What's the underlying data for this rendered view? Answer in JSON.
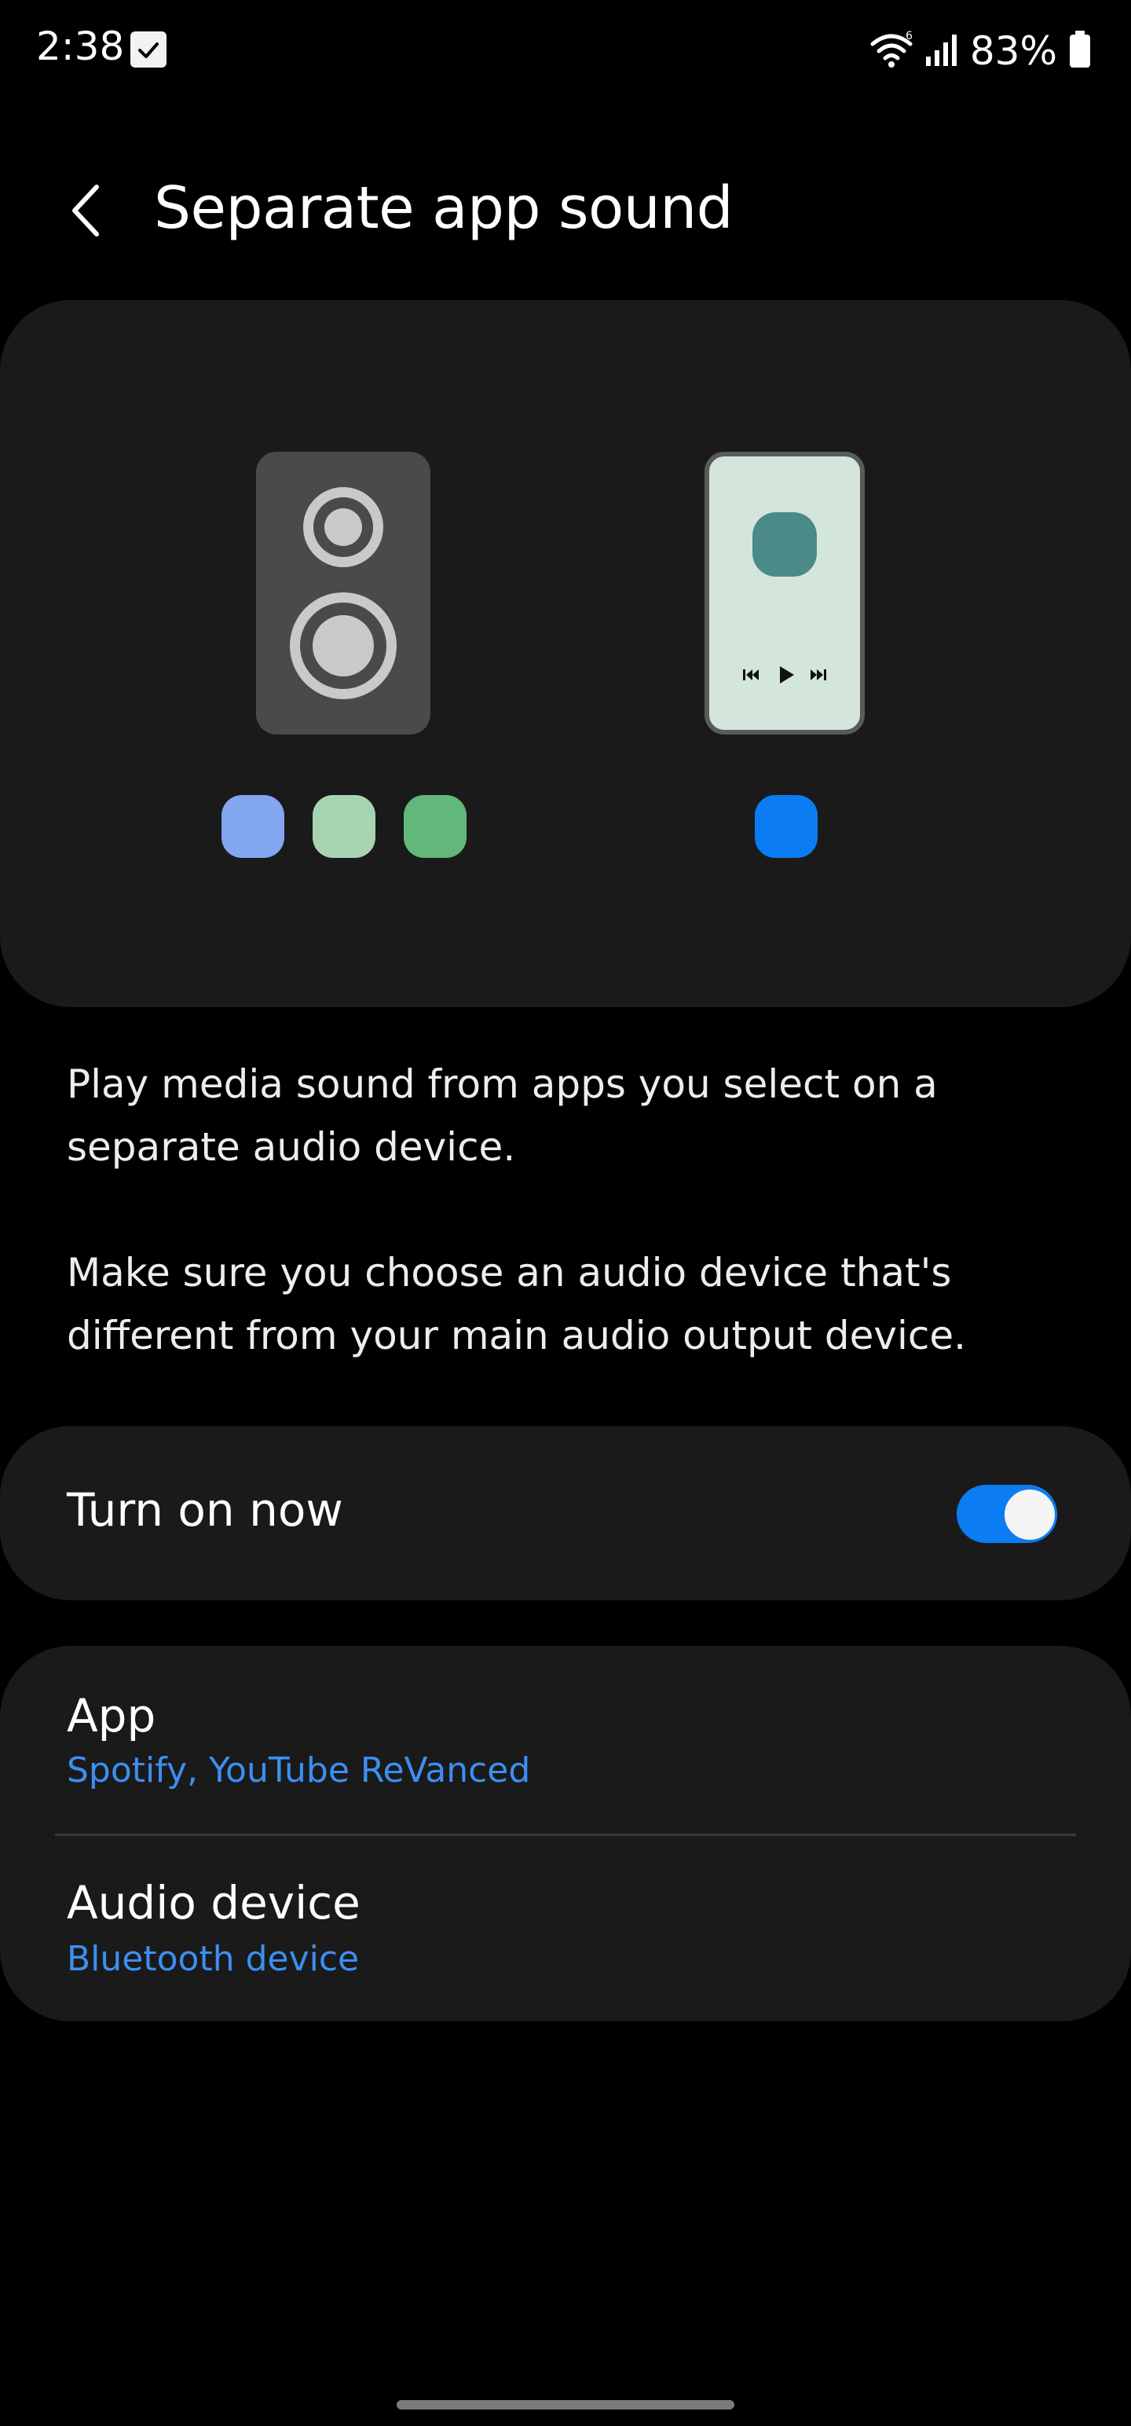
{
  "status_bar": {
    "time": "2:38",
    "battery_percent": "83%",
    "icons": [
      "check-notification-icon",
      "wifi-icon",
      "signal-icon",
      "battery-icon"
    ]
  },
  "header": {
    "title": "Separate app sound",
    "back_icon": "chevron-left-icon"
  },
  "illustration": {
    "speaker_color": "#4a4a4a",
    "phone_screen_color": "#d4e5dc",
    "app_dot_colors": [
      "#82a6f0",
      "#a8d4b2",
      "#62b77a"
    ],
    "phone_dot_color": "#0b7cf2"
  },
  "description": {
    "paragraph1": "Play media sound from apps you select on a separate audio device.",
    "paragraph2": "Make sure you choose an audio device that's different from your main audio output device."
  },
  "toggle": {
    "label": "Turn on now",
    "state": "on",
    "color": "#0b7cf2"
  },
  "settings": {
    "app": {
      "title": "App",
      "value": "Spotify, YouTube ReVanced"
    },
    "audio_device": {
      "title": "Audio device",
      "value": "Bluetooth device"
    }
  },
  "colors": {
    "background": "#000000",
    "card": "#1a1a1a",
    "accent_text": "#3c8ff0"
  }
}
